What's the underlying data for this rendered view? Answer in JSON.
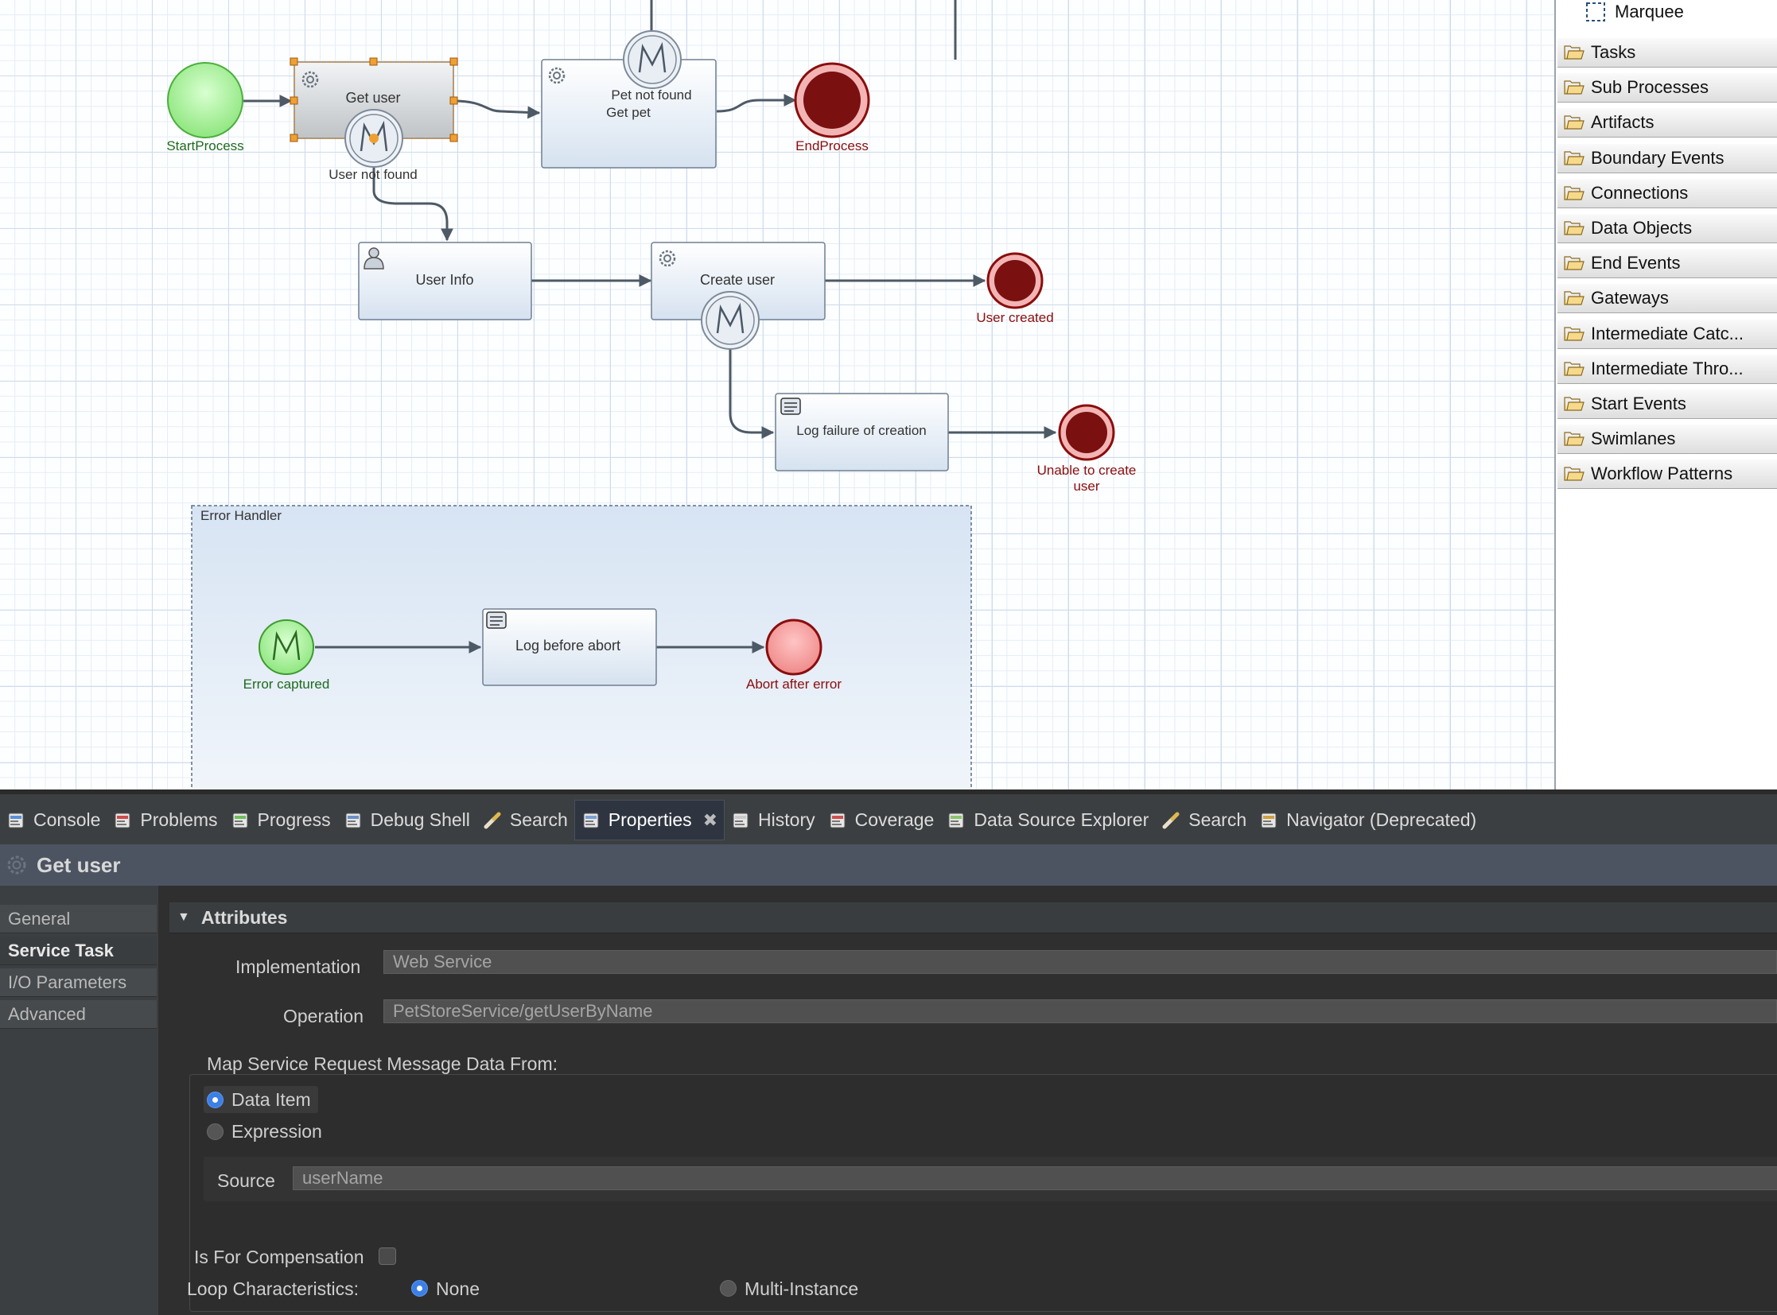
{
  "diagram": {
    "start_event_label": "StartProcess",
    "end_event_label": "EndProcess",
    "get_user_task": "Get user",
    "user_not_found": "User not found",
    "get_pet_task": "Get pet",
    "pet_not_found": "Pet not found",
    "user_info_task": "User Info",
    "create_user_task": "Create user",
    "user_created": "User created",
    "log_failure_task": "Log failure of creation",
    "unable_to_create": [
      "Unable to create",
      "user"
    ],
    "error_handler": {
      "title": "Error Handler",
      "error_captured": "Error captured",
      "log_before_abort": "Log before abort",
      "abort_after_error": "Abort after error"
    }
  },
  "palette": {
    "marquee": "Marquee",
    "drawers": [
      "Tasks",
      "Sub Processes",
      "Artifacts",
      "Boundary Events",
      "Connections",
      "Data Objects",
      "End Events",
      "Gateways",
      "Intermediate Catc...",
      "Intermediate Thro...",
      "Start Events",
      "Swimlanes",
      "Workflow Patterns"
    ]
  },
  "tabs": [
    {
      "label": "Console",
      "icon": "console-icon"
    },
    {
      "label": "Problems",
      "icon": "problems-icon"
    },
    {
      "label": "Progress",
      "icon": "progress-icon"
    },
    {
      "label": "Debug Shell",
      "icon": "debug-shell-icon"
    },
    {
      "label": "Search",
      "icon": "search-icon"
    },
    {
      "label": "Properties",
      "icon": "properties-icon",
      "active": true
    },
    {
      "label": "History",
      "icon": "history-icon"
    },
    {
      "label": "Coverage",
      "icon": "coverage-icon"
    },
    {
      "label": "Data Source Explorer",
      "icon": "data-source-icon"
    },
    {
      "label": "Search",
      "icon": "search-icon"
    },
    {
      "label": "Navigator (Deprecated)",
      "icon": "navigator-icon"
    }
  ],
  "properties": {
    "title": "Get user",
    "nav": [
      "General",
      "Service Task",
      "I/O Parameters",
      "Advanced"
    ],
    "selected_nav": "Service Task",
    "section": "Attributes",
    "implementation_label": "Implementation",
    "implementation_value": "Web Service",
    "operation_label": "Operation",
    "operation_value": "PetStoreService/getUserByName",
    "map_label": "Map Service Request Message Data From:",
    "data_item": "Data Item",
    "expression": "Expression",
    "source_label": "Source",
    "source_value": "userName",
    "compensation_label": "Is For Compensation",
    "loop_label": "Loop Characteristics:",
    "loop_none": "None",
    "loop_multi": "Multi-Instance"
  },
  "colors": {
    "start_fill": "#9be88f",
    "end_fill": "#7a1010",
    "task_fill": "#e7eef7",
    "accent": "#3c7fe6"
  }
}
